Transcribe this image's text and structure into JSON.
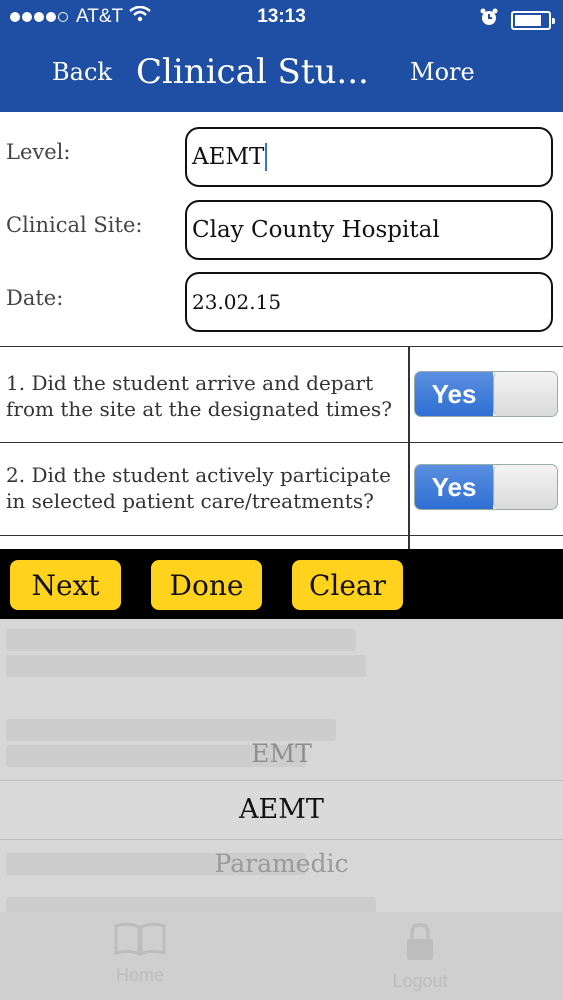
{
  "status_bar": {
    "carrier": "AT&T",
    "time": "13:13"
  },
  "nav": {
    "back_label": "Back",
    "title": "Clinical Stu...",
    "more_label": "More"
  },
  "form": {
    "level": {
      "label": "Level:",
      "value": "AEMT"
    },
    "site": {
      "label": "Clinical  Site:",
      "value": "Clay County Hospital"
    },
    "date": {
      "label": "Date:",
      "value": "23.02.15"
    }
  },
  "questions": [
    {
      "text": "1. Did the student arrive and depart from the site at the designated times?",
      "toggle_label": "Yes",
      "on": true
    },
    {
      "text": "2. Did the student actively participate in selected patient care/treatments?",
      "toggle_label": "Yes",
      "on": true
    }
  ],
  "toolbar": {
    "next_label": "Next",
    "done_label": "Done",
    "clear_label": "Clear"
  },
  "picker": {
    "options": [
      "EMT",
      "AEMT",
      "Paramedic"
    ],
    "selected": "AEMT"
  },
  "tabs": {
    "home_label": "Home",
    "logout_label": "Logout"
  },
  "colors": {
    "nav_bg": "#1e4fa5",
    "toolbar_button": "#ffd21e",
    "toggle_on": "#2f6fd3"
  }
}
